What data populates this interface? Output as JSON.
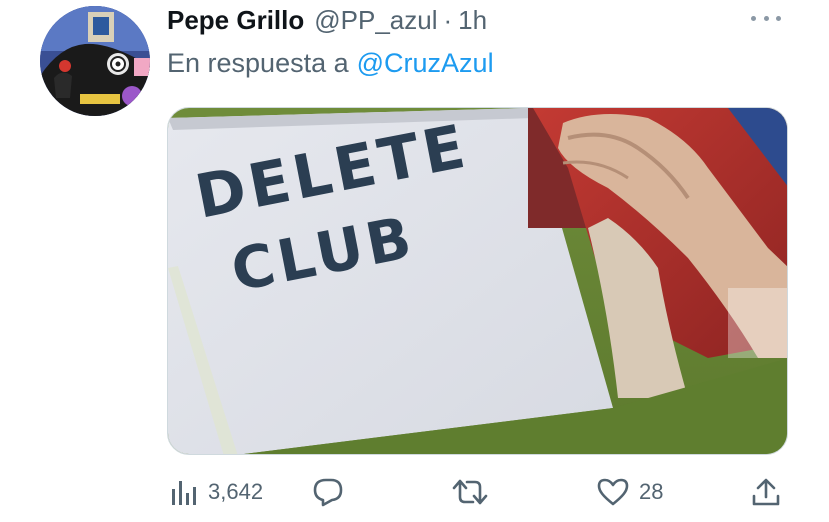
{
  "tweet": {
    "display_name": "Pepe Grillo",
    "handle": "@PP_azul",
    "separator": "·",
    "time": "1h",
    "reply_prefix": "En respuesta a",
    "reply_to": "@CruzAzul"
  },
  "media": {
    "sign_line_1": "DELETE",
    "sign_line_2": "CLUB"
  },
  "actions": {
    "views": "3,642",
    "likes": "28"
  },
  "icons": {
    "more": "more-horizontal-icon",
    "views": "views-chart-icon",
    "reply": "reply-bubble-icon",
    "retweet": "retweet-icon",
    "like": "heart-icon",
    "share": "share-upload-icon"
  },
  "colors": {
    "text_primary": "#0f1419",
    "text_secondary": "#536471",
    "link": "#1d9bf0"
  }
}
